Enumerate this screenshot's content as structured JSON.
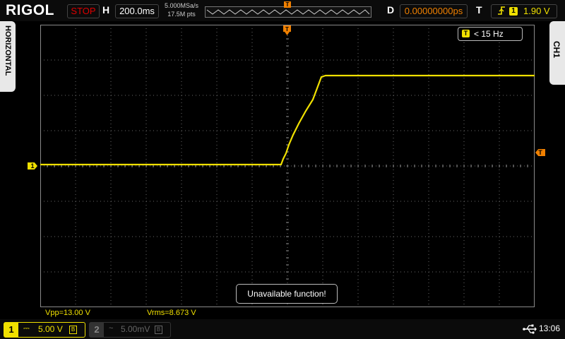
{
  "brand": "RIGOL",
  "header": {
    "run_state": "STOP",
    "h_label": "H",
    "timebase": "200.0ms",
    "sample_rate": "5.000MSa/s",
    "memory_depth": "17.5M pts",
    "d_label": "D",
    "delay": "0.00000000ps",
    "t_label": "T",
    "trigger_edge_icon": "rising-edge-icon",
    "trigger_source": "1",
    "trigger_level": "1.90 V",
    "memory_trigger_marker": "T"
  },
  "side_tabs": {
    "left": "HORIZONTAL",
    "right": "CH1"
  },
  "display": {
    "frequency_marker": "T",
    "frequency": "< 15 Hz",
    "ch1_marker": "1",
    "trigger_level_marker": "T",
    "message": "Unavailable function!"
  },
  "measurements": {
    "vpp": "Vpp=13.00 V",
    "vrms": "Vrms=8.673 V"
  },
  "channels": [
    {
      "number": "1",
      "coupling": "DC",
      "coupling_symbol": "⎓",
      "scale": "5.00 V",
      "bw_limit": "B",
      "active": true,
      "color": "#f0e000"
    },
    {
      "number": "2",
      "coupling": "AC",
      "coupling_symbol": "~",
      "scale": "5.00mV",
      "bw_limit": "B",
      "active": false,
      "color": "#666666"
    }
  ],
  "status": {
    "usb_icon": "usb-icon",
    "time": "13:06"
  },
  "colors": {
    "trace": "#f0e000",
    "trigger": "#f08000",
    "stop": "#dd0000"
  }
}
